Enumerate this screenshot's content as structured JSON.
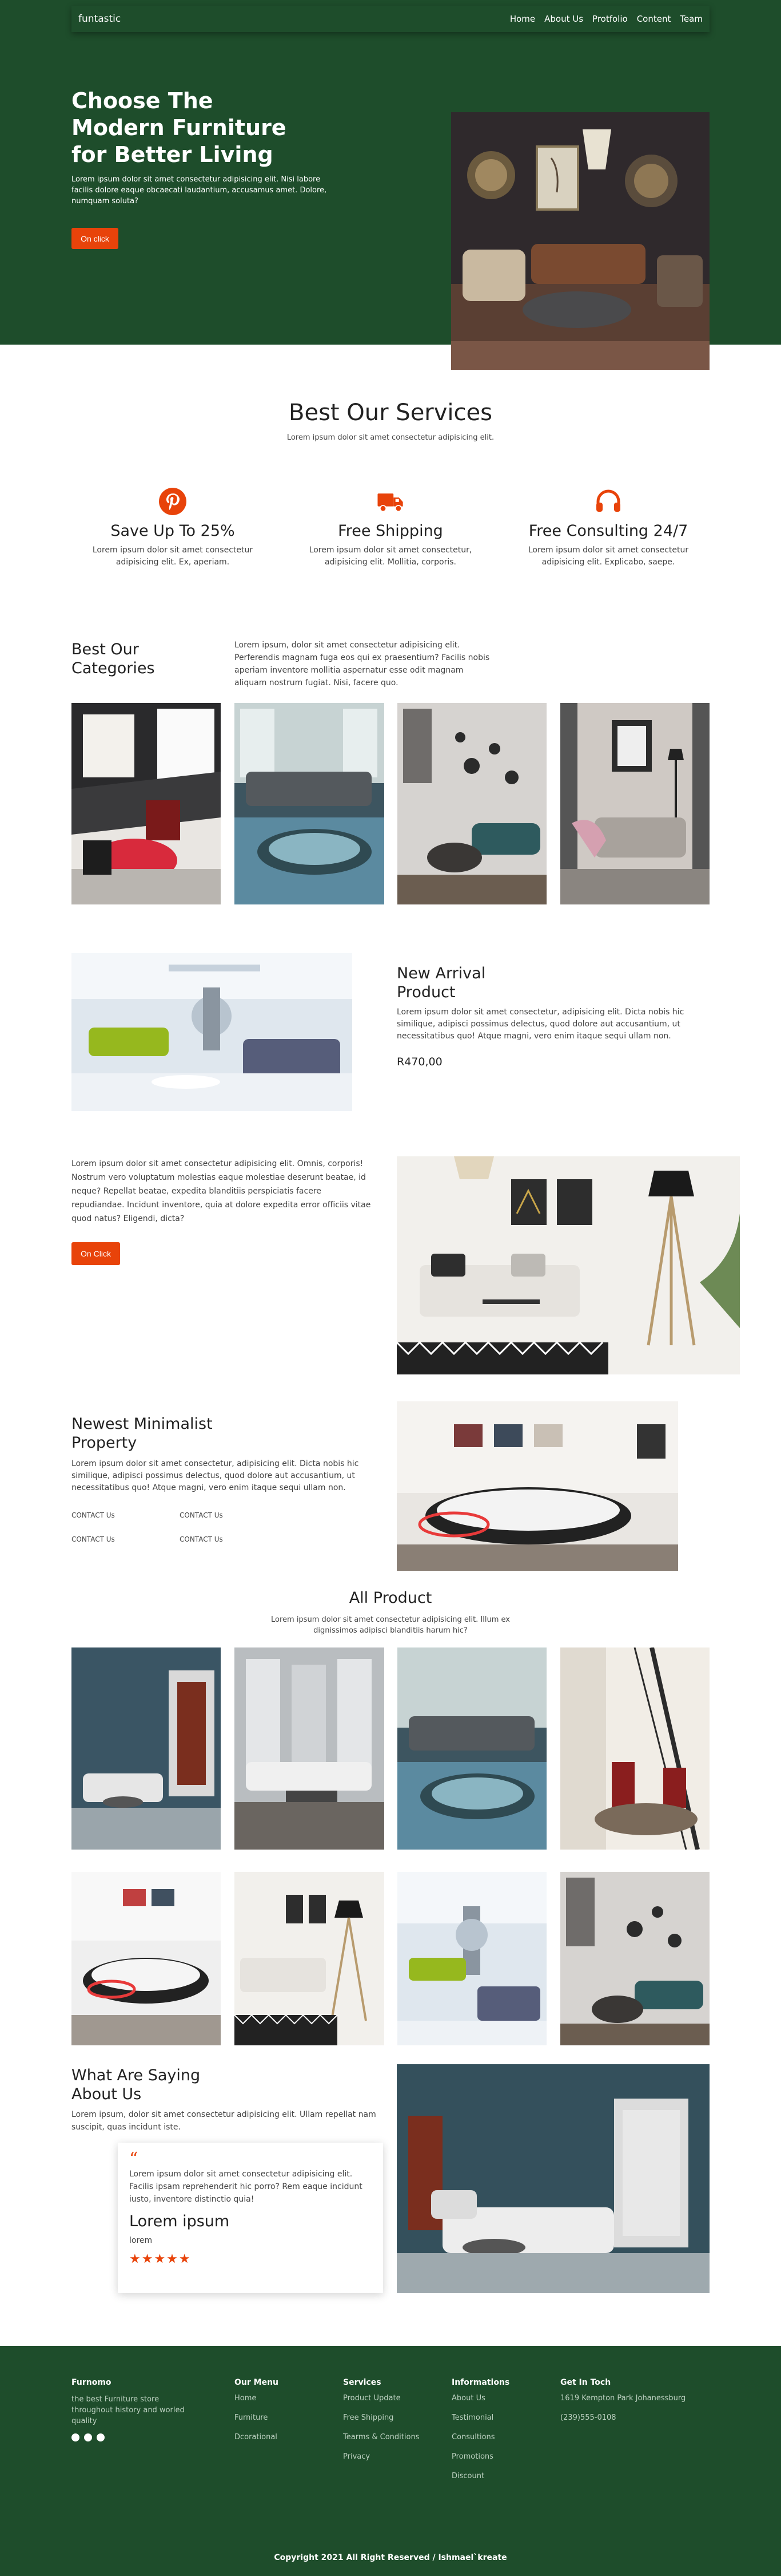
{
  "nav": {
    "brand": "funtastic",
    "links": [
      "Home",
      "About Us",
      "Protfolio",
      "Content",
      "Team"
    ]
  },
  "hero": {
    "title": "Choose The Modern Furniture for Better Living",
    "text": "Lorem ipsum dolor sit amet consectetur adipisicing elit. Nisi labore facilis dolore eaque obcaecati laudantium, accusamus amet. Dolore, numquam soluta?",
    "button": "On click"
  },
  "services": {
    "title": "Best Our Services",
    "subtitle": "Lorem ipsum dolor sit amet consectetur adipisicing elit.",
    "items": [
      {
        "icon": "pinterest-icon",
        "title": "Save Up To 25%",
        "text": "Lorem ipsum dolor sit amet consectetur adipisicing elit. Ex, aperiam."
      },
      {
        "icon": "truck-icon",
        "title": "Free Shipping",
        "text": "Lorem ipsum dolor sit amet consectetur, adipisicing elit. Mollitia, corporis."
      },
      {
        "icon": "headphones-icon",
        "title": "Free Consulting 24/7",
        "text": "Lorem ipsum dolor sit amet consectetur adipisicing elit. Explicabo, saepe."
      }
    ]
  },
  "categories": {
    "title": "Best Our Categories",
    "text": "Lorem ipsum, dolor sit amet consectetur adipisicing elit. Perferendis magnam fuga eos qui ex praesentium? Facilis nobis aperiam inventore mollitia aspernatur esse odit magnam aliquam nostrum fugiat. Nisi, facere quo."
  },
  "new_arrival": {
    "title": "New Arrival Product",
    "text": "Lorem ipsum dolor sit amet consectetur, adipisicing elit. Dicta nobis hic similique, adipisci possimus delectus, quod dolore aut accusantium, ut necessitatibus quo! Atque magni, vero enim itaque sequi ullam non.",
    "price": "R470,00"
  },
  "promo": {
    "text": "Lorem ipsum dolor sit amet consectetur adipisicing elit. Omnis, corporis! Nostrum vero voluptatum molestias eaque molestiae deserunt beatae, id neque? Repellat beatae, expedita blanditiis perspiciatis facere repudiandae. Incidunt inventore, quia at dolore expedita error officiis vitae quod natus? Eligendi, dicta?",
    "button": "On Click"
  },
  "minimalist": {
    "title": "Newest Minimalist Property",
    "text": "Lorem ipsum dolor sit amet consectetur, adipisicing elit. Dicta nobis hic similique, adipisci possimus delectus, quod dolore aut accusantium, ut necessitatibus quo! Atque magni, vero enim itaque sequi ullam non.",
    "contacts": [
      "CONTACT Us",
      "CONTACT Us",
      "CONTACT Us",
      "CONTACT Us"
    ]
  },
  "all_product": {
    "title": "All Product",
    "subtitle": "Lorem ipsum dolor sit amet consectetur adipisicing elit. Illum ex dignissimos adipisci blanditiis harum hic?"
  },
  "saying": {
    "title": "What Are Saying About Us",
    "text": "Lorem ipsum, dolor sit amet consectetur adipisicing elit. Ullam repellat nam suscipit, quas incidunt iste.",
    "quote": "Lorem ipsum dolor sit amet consectetur adipisicing elit. Facilis ipsam reprehenderit hic porro? Rem eaque incidunt iusto, inventore distinctio quia!",
    "name": "Lorem ipsum",
    "role": "lorem",
    "stars": "★★★★★"
  },
  "footer": {
    "brand": "Furnomo",
    "desc": "the best Furniture store throughout history and worled quality",
    "menu_title": "Our Menu",
    "menu": [
      "Home",
      "Furniture",
      "Dcorational"
    ],
    "services_title": "Services",
    "services": [
      "Product Update",
      "Free Shipping",
      "Tearms & Conditions",
      "Privacy"
    ],
    "info_title": "Informations",
    "info": [
      "About Us",
      "Testimonial",
      "Consultions",
      "Promotions",
      "Discount"
    ],
    "touch_title": "Get In Toch",
    "touch": [
      "1619 Kempton Park Johanessburg",
      "(239)555-0108"
    ],
    "copyright": "Copyright 2021 All Right Reserved / Ishmael`kreate"
  },
  "colors": {
    "primary_green": "#1e4d2b",
    "accent_orange": "#e8430a"
  }
}
